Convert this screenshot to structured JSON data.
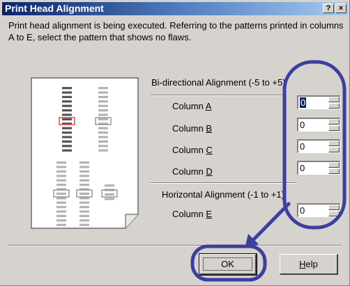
{
  "window": {
    "title": "Print Head Alignment",
    "help_glyph": "?",
    "close_glyph": "×"
  },
  "instruction": "Print head alignment is being executed. Referring to the patterns printed in columns A to E, select the pattern that shows no flaws.",
  "bidirectional": {
    "title": "Bi-directional Alignment (-5 to +5)",
    "rows": [
      {
        "label_prefix": "Column ",
        "label_key": "A",
        "value": "0"
      },
      {
        "label_prefix": "Column ",
        "label_key": "B",
        "value": "0"
      },
      {
        "label_prefix": "Column ",
        "label_key": "C",
        "value": "0"
      },
      {
        "label_prefix": "Column ",
        "label_key": "D",
        "value": "0"
      }
    ]
  },
  "horizontal": {
    "title": "Horizontal Alignment (-1 to +1)",
    "rows": [
      {
        "label_prefix": "Column ",
        "label_key": "E",
        "value": "0"
      }
    ]
  },
  "buttons": {
    "ok": "OK",
    "help": "Help",
    "help_key": "H",
    "help_rest": "elp"
  },
  "colors": {
    "annotation": "#3a3fa0",
    "highlight_box": "#e03030"
  }
}
